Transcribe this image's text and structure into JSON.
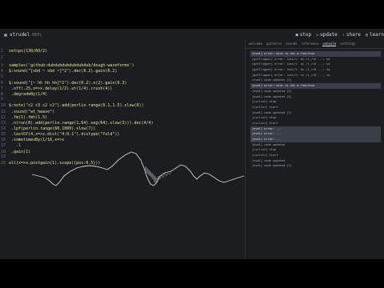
{
  "app": {
    "title": "strudel",
    "version": "REPL",
    "buttons": [
      {
        "label": "stop",
        "icon": "stop-icon"
      },
      {
        "label": "update",
        "icon": "refresh-icon"
      },
      {
        "label": "share",
        "icon": "share-icon"
      },
      {
        "label": "learn",
        "icon": "book-icon"
      }
    ]
  },
  "editor": {
    "lines": [
      {
        "n": "1",
        "text": "setcps(130/60/2)"
      },
      {
        "n": "2",
        "text": ""
      },
      {
        "n": "3",
        "text": "samples('github:dubdubdubdubdubdub/dough-waveforms')"
      },
      {
        "n": "4",
        "text": "$:sound(\"[sbd ~ sbd ~]*2\").dec(0.2).gain(0.2)"
      },
      {
        "n": "5",
        "text": ""
      },
      {
        "n": "6",
        "text": "$:sound(\"[~ hh hh hh]*2\").dec(0.2).n(2).gain(0.3)"
      },
      {
        "n": "7",
        "text": " .off(.25,x=>x.delay(1/2).ut(1/4).crush(4))"
      },
      {
        "n": "8",
        "text": " .degradeBy(1/4)"
      },
      {
        "n": "9",
        "text": ""
      },
      {
        "n": "10",
        "text": "$:note(\"c2 c3 c2 c2\").add(perlin.range(0.1,1.5).slow(8))"
      },
      {
        "n": "11",
        "text": " .sound(\"wt_hwave\")"
      },
      {
        "n": "12",
        "text": " .fm(1).fmh(1.5)"
      },
      {
        "n": "13",
        "text": " .n(run(8).add(perlin.range(1,64).seg(64).slow(3))).dec(4/4)"
      },
      {
        "n": "14",
        "text": " .lpf(perlin.range(60,1000).slow(7))"
      },
      {
        "n": "15",
        "text": " .lastOf(4,x=>x.dist(\"4:0.1\").distype(\"fold\"))"
      },
      {
        "n": "16",
        "text": " .sometimesBy(1/16,x=>x"
      },
      {
        "n": "17",
        "text": "   .l"
      },
      {
        "n": "18",
        "text": " .gain(1)"
      },
      {
        "n": "19",
        "text": ""
      },
      {
        "n": "20",
        "text": "all(x=>x.postgain(1).scope({pos:0.5}))"
      }
    ]
  },
  "panel": {
    "tabs": [
      "welcome",
      "patterns",
      "sounds",
      "reference",
      "console",
      "settings"
    ],
    "active_tab": "console",
    "log": [
      "[eval] error: mini is not a function",
      "[getTrigger] error: last/t: as /t_/=0 ...; sd",
      "[getTrigger] error: last/t: as /t_/=0 ...; sd",
      "[getTrigger] error: last/t: as /t_/=0 ...; sd",
      "[getTrigger] error: last/t: as /t_/=0 ...; sd",
      "[eval] code updated [2]",
      "[eval] error: mini is not a function",
      "[eval] code updated [3]",
      "[eval] code updated [4]",
      "[cyclist] stop",
      "[cyclist] start",
      "[eval] code updated [7]",
      "[cyclist] stop",
      "[cyclist] start",
      "[eval] error: ...",
      "[eval] error: ...",
      "[eval] error: ...",
      "[eval] code updated",
      "[cyclist] stop",
      "[cyclist] start",
      "[eval] code updated",
      "[eval] code updated [?]"
    ],
    "highlighted_rows": [
      0,
      6,
      14,
      15,
      16
    ]
  }
}
